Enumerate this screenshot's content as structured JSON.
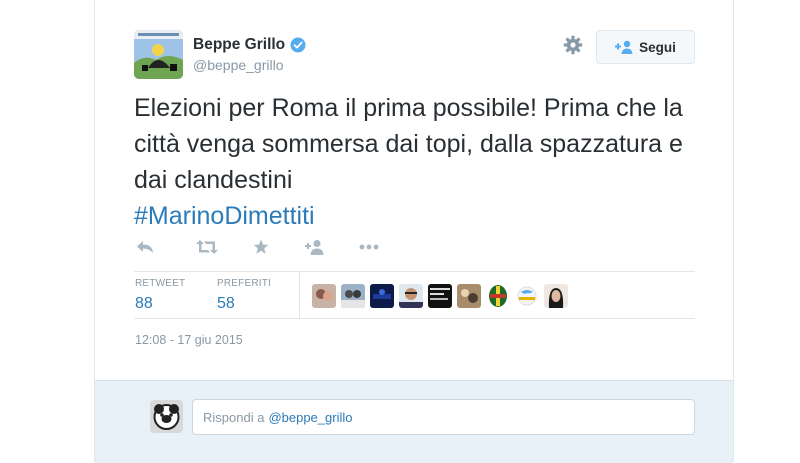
{
  "author": {
    "name": "Beppe Grillo",
    "handle": "@beppe_grillo",
    "verified": true
  },
  "header": {
    "follow_label": "Segui"
  },
  "tweet": {
    "text": "Elezioni per Roma il prima possibile! Prima che la città venga sommersa dai topi, dalla spazzatura e dai clandestini",
    "hashtag": "#MarinoDimettiti"
  },
  "actions": [
    "reply-icon",
    "retweet-icon",
    "favorite-icon",
    "follow-user-icon",
    "more-icon"
  ],
  "stats": {
    "retweet_label": "RETWEET",
    "retweet_count": "88",
    "favorites_label": "PREFERITI",
    "favorites_count": "58"
  },
  "timestamp": "12:08 - 17 giu 2015",
  "reply": {
    "prefix": "Rispondi a",
    "mention": "@beppe_grillo"
  },
  "colors": {
    "link": "#2b7bb9",
    "muted": "#8899a6",
    "text": "#292f33",
    "reply_bg": "#e8f0f8"
  }
}
